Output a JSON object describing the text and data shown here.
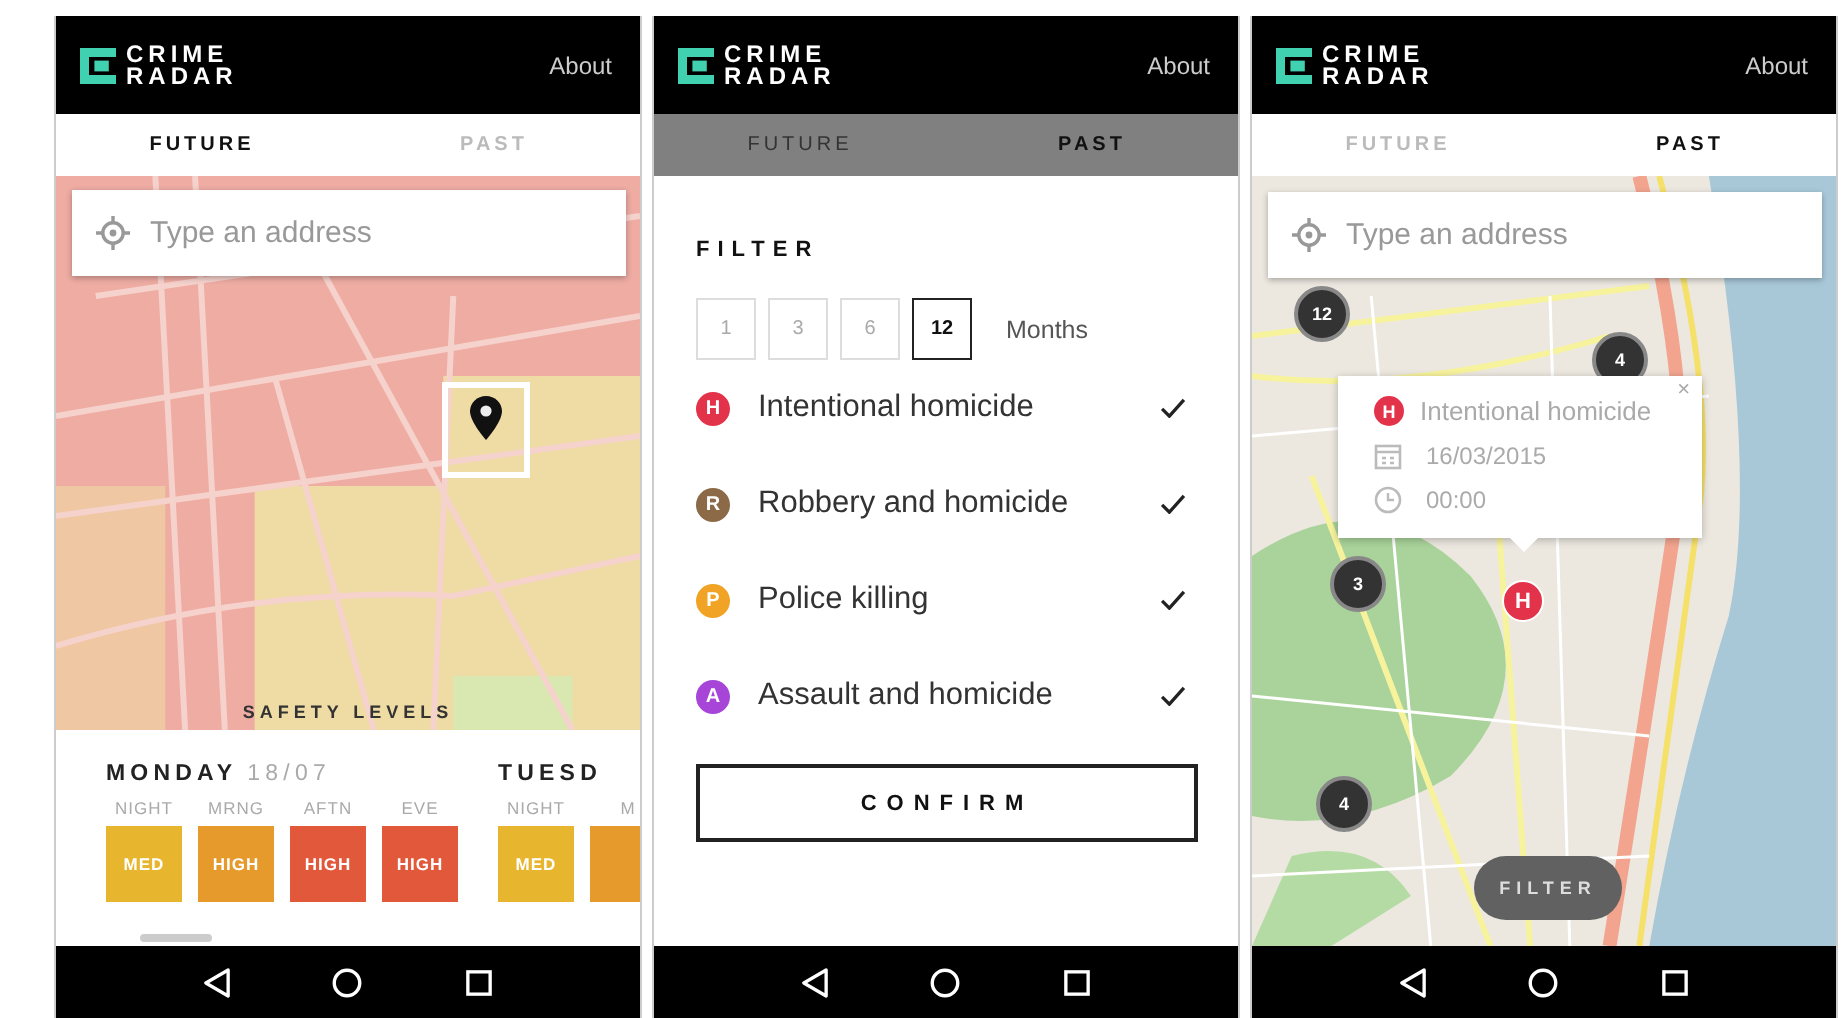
{
  "screens": [
    {
      "kind": "forecast",
      "header": {
        "logo": "CRIME RADAR",
        "about": "About"
      },
      "tabs_dimmed": false,
      "tabs": [
        {
          "label": "FUTURE",
          "selected": true
        },
        {
          "label": "PAST",
          "selected": false
        }
      ],
      "search": {
        "placeholder": "Type an address"
      },
      "map_caption": "SAFETY LEVELS",
      "days": [
        {
          "name": "MONDAY",
          "date": "18/07",
          "slots": [
            {
              "label": "NIGHT",
              "rating": "MED",
              "color": "#e8b62e"
            },
            {
              "label": "MRNG",
              "rating": "HIGH",
              "color": "#e59a2b"
            },
            {
              "label": "AFTN",
              "rating": "HIGH",
              "color": "#e2583a"
            },
            {
              "label": "EVE",
              "rating": "HIGH",
              "color": "#e2583a"
            }
          ]
        },
        {
          "name": "TUESD",
          "slots": [
            {
              "label": "NIGHT",
              "rating": "MED",
              "color": "#e8b62e"
            },
            {
              "label": "M",
              "color": "#e59a2b"
            }
          ]
        }
      ]
    },
    {
      "kind": "filter",
      "header": {
        "logo": "CRIME RADAR",
        "about": "About"
      },
      "tabs_dimmed": true,
      "tabs": [
        {
          "label": "FUTURE",
          "selected": false
        },
        {
          "label": "PAST",
          "selected": true
        }
      ],
      "title": "FILTER",
      "months": [
        {
          "label": "1",
          "selected": false
        },
        {
          "label": "3",
          "selected": false
        },
        {
          "label": "6",
          "selected": false
        },
        {
          "label": "12",
          "selected": true
        }
      ],
      "months_label": "Months",
      "crimes": [
        {
          "badge": "H",
          "label": "Intentional homicide",
          "color": "#e3334a",
          "checked": true
        },
        {
          "badge": "R",
          "label": "Robbery and homicide",
          "color": "#8c6a48",
          "checked": true
        },
        {
          "badge": "P",
          "label": "Police killing",
          "color": "#f0a324",
          "checked": true
        },
        {
          "badge": "A",
          "label": "Assault and homicide",
          "color": "#a645d8",
          "checked": true
        }
      ],
      "confirm": "CONFIRM"
    },
    {
      "kind": "map",
      "header": {
        "logo": "CRIME RADAR",
        "about": "About"
      },
      "tabs_dimmed": false,
      "tabs": [
        {
          "label": "FUTURE",
          "selected": false
        },
        {
          "label": "PAST",
          "selected": true
        }
      ],
      "search": {
        "placeholder": "Type an address"
      },
      "clusters": [
        {
          "count": "12"
        },
        {
          "count": "4"
        },
        {
          "count": "3"
        },
        {
          "count": "4"
        }
      ],
      "popup": {
        "badge": "H",
        "color": "#e3334a",
        "title": "Intentional homicide",
        "date": "16/03/2015",
        "time": "00:00",
        "close": "×"
      },
      "marker": {
        "badge": "H",
        "color": "#e3334a"
      },
      "filter_button": "FILTER"
    }
  ]
}
